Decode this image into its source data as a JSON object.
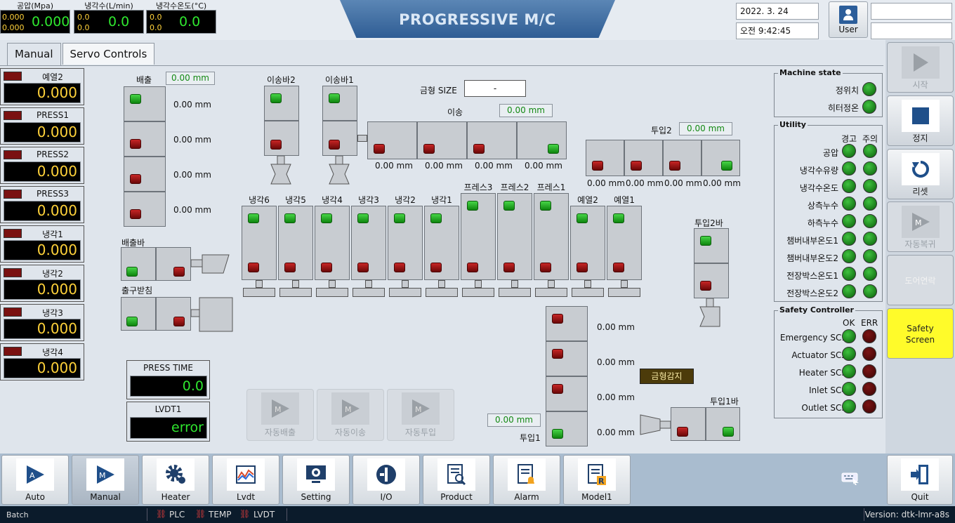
{
  "gauges": [
    {
      "title": "공압(Mpa)",
      "v1": "0.000",
      "v2": "0.000",
      "big": "0.000"
    },
    {
      "title": "냉각수(L/min)",
      "v1": "0.0",
      "v2": "0.0",
      "big": "0.0"
    },
    {
      "title": "냉각수온도(°C)",
      "v1": "0.0",
      "v2": "0.0",
      "big": "0.0"
    }
  ],
  "app_title": "PROGRESSIVE M/C",
  "date": "2022. 3. 24",
  "time": "오전 9:42:45",
  "user_label": "User",
  "tabs": [
    "Manual",
    "Servo Controls"
  ],
  "left_meters": [
    {
      "label": "예열2",
      "value": "0.000"
    },
    {
      "label": "PRESS1",
      "value": "0.000"
    },
    {
      "label": "PRESS2",
      "value": "0.000"
    },
    {
      "label": "PRESS3",
      "value": "0.000"
    },
    {
      "label": "냉각1",
      "value": "0.000"
    },
    {
      "label": "냉각2",
      "value": "0.000"
    },
    {
      "label": "냉각3",
      "value": "0.000"
    },
    {
      "label": "냉각4",
      "value": "0.000"
    }
  ],
  "press_time": {
    "label": "PRESS TIME",
    "value": "0.0"
  },
  "lvdt1": {
    "label": "LVDT1",
    "value": "error"
  },
  "discharge": {
    "label": "배출",
    "mm": "0.00 mm",
    "rows": [
      "0.00 mm",
      "0.00 mm",
      "0.00 mm",
      "0.00 mm"
    ]
  },
  "transfer_bars": [
    "이송바2",
    "이송바1"
  ],
  "mold_size": {
    "label": "금형 SIZE",
    "value": "-"
  },
  "transfer": {
    "label": "이송",
    "mm": "0.00 mm",
    "cells": [
      "0.00 mm",
      "0.00 mm",
      "0.00 mm",
      "0.00 mm"
    ]
  },
  "input2": {
    "label": "투입2",
    "mm": "0.00 mm",
    "cells": [
      "0.00 mm",
      "0.00 mm",
      "0.00 mm",
      "0.00 mm"
    ]
  },
  "stations": [
    "냉각6",
    "냉각5",
    "냉각4",
    "냉각3",
    "냉각2",
    "냉각1",
    "프레스3",
    "프레스2",
    "프레스1",
    "예열2",
    "예열1"
  ],
  "discharge_bar": "배출바",
  "output_receiver": "출구받침",
  "input2_bar": "투입2바",
  "input1_bar": "투입1바",
  "input1": {
    "label": "투입1",
    "mm": "0.00 mm",
    "rows": [
      "0.00 mm",
      "0.00 mm",
      "0.00 mm",
      "0.00 mm"
    ]
  },
  "mold_detect": "금형감지",
  "auto_buttons": [
    "자동배출",
    "자동이송",
    "자동투입"
  ],
  "machine_state": {
    "title": "Machine state",
    "items": [
      "정위치",
      "히터정온"
    ]
  },
  "utility": {
    "title": "Utility",
    "cols": [
      "경고",
      "주의"
    ],
    "items": [
      "공압",
      "냉각수유량",
      "냉각수온도",
      "상측누수",
      "하측누수",
      "챔버내부온도1",
      "챔버내부온도2",
      "전장박스온도1",
      "전장박스온도2"
    ]
  },
  "safety": {
    "title": "Safety Controller",
    "cols": [
      "OK",
      "ERR"
    ],
    "items": [
      "Emergency SC1",
      "Actuator SC2",
      "Heater SC3",
      "Inlet SC4",
      "Outlet SC5"
    ]
  },
  "side_buttons": {
    "start": "시작",
    "stop": "정지",
    "reset": "리셋",
    "auto_return": "자동복귀",
    "door_link": "도어연락",
    "safety_line1": "Safety",
    "safety_line2": "Screen"
  },
  "nav": [
    "Auto",
    "Manual",
    "Heater",
    "Lvdt",
    "Setting",
    "I/O",
    "Product",
    "Alarm",
    "Model1"
  ],
  "quit": "Quit",
  "status": {
    "batch": "Batch",
    "plc": "PLC",
    "temp": "TEMP",
    "lvdt": "LVDT",
    "version": "Version: dtk-lmr-a8s"
  }
}
